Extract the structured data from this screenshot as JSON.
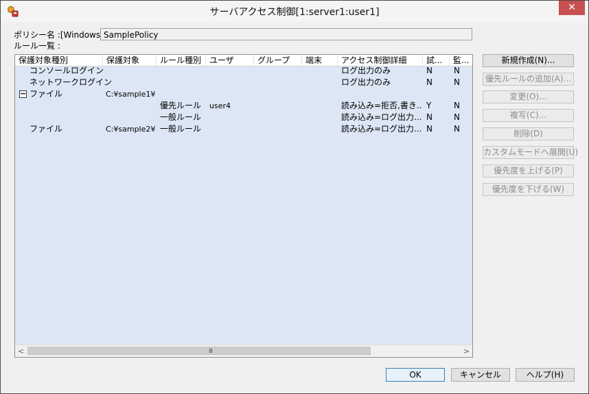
{
  "window": {
    "title": "サーバアクセス制御[1:server1:user1]",
    "close_label": "✕"
  },
  "policy": {
    "label": "ポリシー名 :[Windows]",
    "value": "SamplePolicy"
  },
  "rules_label": "ルール一覧 :",
  "grid": {
    "columns": [
      "保護対象種別",
      "保護対象",
      "ルール種別",
      "ユーザ",
      "グループ",
      "端末",
      "アクセス制御詳細",
      "試...",
      "監..."
    ],
    "rows": [
      {
        "type": "コンソールログイン",
        "target": "",
        "rule": "",
        "user": "",
        "group": "",
        "terminal": "",
        "detail": "ログ出力のみ",
        "trial": "N",
        "audit": "N",
        "toggle": ""
      },
      {
        "type": "ネットワークログイン",
        "target": "",
        "rule": "",
        "user": "",
        "group": "",
        "terminal": "",
        "detail": "ログ出力のみ",
        "trial": "N",
        "audit": "N",
        "toggle": ""
      },
      {
        "type": "ファイル",
        "target": "C:¥sample1¥",
        "rule": "",
        "user": "",
        "group": "",
        "terminal": "",
        "detail": "",
        "trial": "",
        "audit": "",
        "toggle": "−"
      },
      {
        "type": "",
        "target": "",
        "rule": "優先ルール",
        "user": "user4",
        "group": "",
        "terminal": "",
        "detail": "読み込み=拒否,書き...",
        "trial": "Y",
        "audit": "N",
        "toggle": ""
      },
      {
        "type": "",
        "target": "",
        "rule": "一般ルール",
        "user": "",
        "group": "",
        "terminal": "",
        "detail": "読み込み=ログ出力...",
        "trial": "N",
        "audit": "N",
        "toggle": ""
      },
      {
        "type": "ファイル",
        "target": "C:¥sample2¥",
        "rule": "一般ルール",
        "user": "",
        "group": "",
        "terminal": "",
        "detail": "読み込み=ログ出力...",
        "trial": "N",
        "audit": "N",
        "toggle": ""
      }
    ],
    "scroll": {
      "left": "<",
      "right": ">",
      "grip": "III"
    }
  },
  "side_buttons": [
    {
      "label": "新規作成(N)...",
      "enabled": true
    },
    {
      "label": "優先ルールの追加(A)...",
      "enabled": false
    },
    {
      "label": "変更(O)...",
      "enabled": false
    },
    {
      "label": "複写(C)...",
      "enabled": false
    },
    {
      "label": "削除(D)",
      "enabled": false
    },
    {
      "label": "カスタムモードへ展開(U)",
      "enabled": false
    },
    {
      "label": "優先度を上げる(P)",
      "enabled": false
    },
    {
      "label": "優先度を下げる(W)",
      "enabled": false
    }
  ],
  "footer": {
    "ok": "OK",
    "cancel": "キャンセル",
    "help": "ヘルプ(H)"
  },
  "colors": {
    "grid_background": "#dce6f4",
    "close_button": "#c75050"
  },
  "icons": {
    "app": "server-access-icon",
    "close": "close-icon"
  }
}
